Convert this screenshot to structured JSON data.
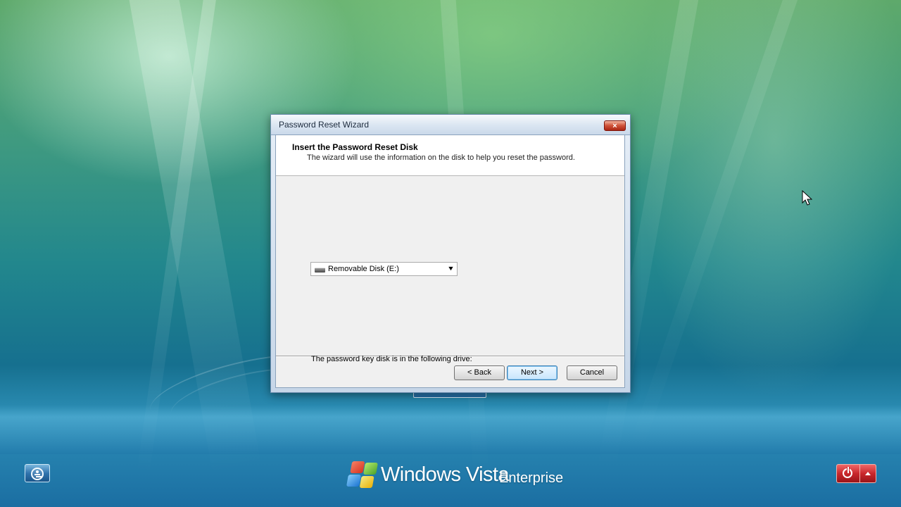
{
  "dialog": {
    "title": "Password Reset Wizard",
    "close_icon": "close-icon",
    "header": {
      "title": "Insert the Password Reset Disk",
      "subtitle": "The wizard will use the information on the disk to help you reset the password."
    },
    "drive_prompt": "The password key disk is in the following drive:",
    "drive_select": {
      "selected": "Removable Disk (E:)",
      "icon": "removable-disk-icon"
    },
    "buttons": {
      "back": "< Back",
      "next": "Next >",
      "cancel": "Cancel"
    }
  },
  "desktop": {
    "brand": {
      "product": "Windows Vista",
      "edition": "Enterprise",
      "logo_icon": "windows-flag-icon"
    },
    "ease_access_icon": "ease-of-access-icon",
    "power_icon": "power-icon",
    "power_options_icon": "up-arrow-icon",
    "cursor_icon": "mouse-pointer-icon"
  },
  "colors": {
    "wizard_frame": "#c6d6e8",
    "next_button_accent": "#3c7fb1",
    "power_button": "#c7262a",
    "desktop_blue": "#16708f",
    "desktop_green": "#5ea96b"
  }
}
